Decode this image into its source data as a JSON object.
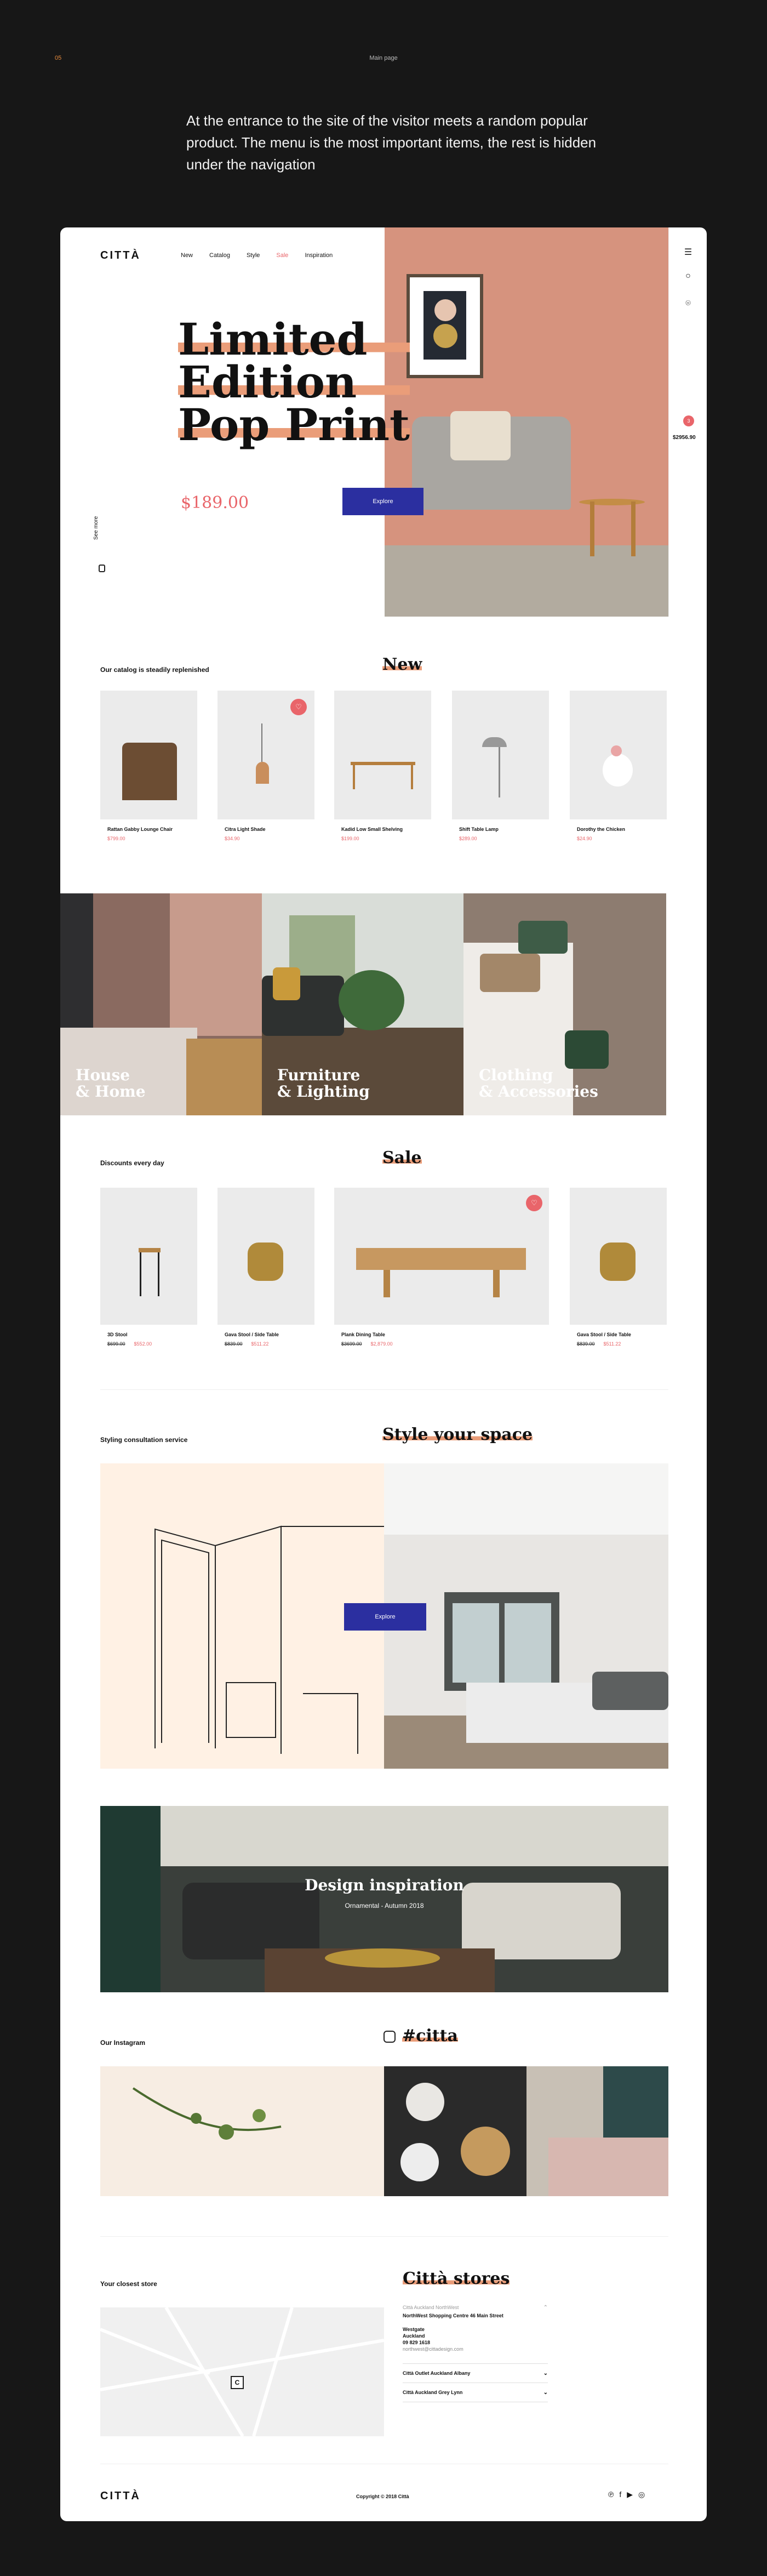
{
  "presentation": {
    "number": "05",
    "title": "Main page",
    "description": "At the entrance to the site of the visitor meets a random popular product. The menu is the most important items, the rest is hidden under the navigation"
  },
  "header": {
    "logo": "CITTÀ",
    "nav": [
      "New",
      "Catalog",
      "Style",
      "Sale",
      "Inspiration"
    ]
  },
  "hero": {
    "title_lines": [
      "Limited",
      "Edition",
      "Pop Print"
    ],
    "price": "$189.00",
    "button": "Explore",
    "see_more": "See more"
  },
  "sidebar": {
    "cart_count": "3",
    "cart_total": "$2956.90"
  },
  "new_section": {
    "subtitle": "Our catalog is steadily replenished",
    "title": "New",
    "products": [
      {
        "name": "Rattan Gabby Lounge Chair",
        "price": "$799.00"
      },
      {
        "name": "Citra Light Shade",
        "price": "$34.90"
      },
      {
        "name": "Kadid Low Small Shelving",
        "price": "$199.00"
      },
      {
        "name": "Shift Table Lamp",
        "price": "$289.00"
      },
      {
        "name": "Dorothy the Chicken",
        "price": "$24.90"
      }
    ]
  },
  "categories": [
    {
      "line1": "House",
      "line2": "& Home"
    },
    {
      "line1": "Furniture",
      "line2": "& Lighting"
    },
    {
      "line1": "Clothing",
      "line2": "& Accessories"
    }
  ],
  "sale_section": {
    "subtitle": "Discounts every day",
    "title": "Sale",
    "products": [
      {
        "name": "3D Stool",
        "old": "$699.00",
        "price": "$552.00"
      },
      {
        "name": "Gava Stool / Side Table",
        "old": "$839.00",
        "price": "$511.22"
      },
      {
        "name": "Plank Dining Table",
        "old": "$3699.00",
        "price": "$2,879.00"
      },
      {
        "name": "Gava Stool / Side Table",
        "old": "$839.00",
        "price": "$511.22"
      }
    ]
  },
  "style_section": {
    "subtitle": "Styling consultation service",
    "title": "Style your space",
    "button": "Explore"
  },
  "inspiration": {
    "title": "Design inspiration",
    "subtitle": "Ornamental - Autumn 2018"
  },
  "instagram": {
    "subtitle": "Our Instagram",
    "title": "#citta"
  },
  "stores": {
    "subtitle": "Your closest store",
    "title": "Città stores",
    "open_store": {
      "name": "Città Auckland NorthWest",
      "line1": "NorthWest Shopping Centre 46 Main Street",
      "line2": "Westgate",
      "line3": "Auckland",
      "phone": "09 829 1618",
      "email": "northwest@cittadesign.com"
    },
    "others": [
      "Città Outlet Auckland Albany",
      "Città Auckland Grey Lynn"
    ]
  },
  "footer": {
    "logo": "CITTÀ",
    "copyright": "Copyright © 2018 Città"
  },
  "colors": {
    "accent": "#e9656a",
    "button": "#2b2fa0",
    "highlight": "#ea9d79"
  }
}
